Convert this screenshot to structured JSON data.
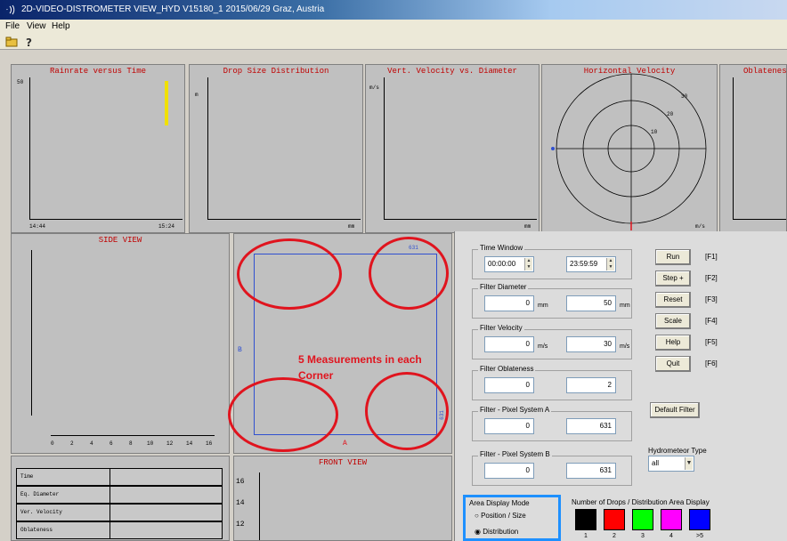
{
  "window": {
    "title": "2D-VIDEO-DISTROMETER   VIEW_HYD   V15180_1   2015/06/29   Graz, Austria"
  },
  "menu": [
    "File",
    "View",
    "Help"
  ],
  "toolbar_icons": [
    "folder-open-icon",
    "help-icon"
  ],
  "panels": {
    "rain_rate": {
      "title": "Rainrate versus Time",
      "y_top": "50",
      "x_left": "14:44",
      "x_right": "15:24"
    },
    "dsd": {
      "title": "Drop Size Distribution",
      "y_unit": "m",
      "x_unit": "mm"
    },
    "vel_diam": {
      "title": "Vert. Velocity vs. Diameter",
      "y_unit": "m/s",
      "x_unit": "mm"
    },
    "horiz_vel": {
      "title": "Horizontal Velocity",
      "ring_labels": [
        "10",
        "20",
        "30"
      ],
      "unit": "m/s"
    },
    "oblateness": {
      "title": "Oblateness"
    },
    "side_view": {
      "title": "SIDE VIEW",
      "x_ticks": [
        "0",
        "2",
        "4",
        "6",
        "8",
        "10",
        "12",
        "14",
        "16"
      ]
    },
    "camera_a": {
      "x_label": "A",
      "y_label": "B",
      "corner_label": "631",
      "side_label": "631"
    },
    "front_view": {
      "title": "FRONT VIEW",
      "y_ticks": [
        "16",
        "14",
        "12"
      ]
    }
  },
  "annotation": {
    "line1": "5 Measurements in each",
    "line2": "Corner"
  },
  "info_table": [
    "Time",
    "Eq. Diameter",
    "Ver. Velocity",
    "Oblateness"
  ],
  "controls": {
    "time_window": {
      "label": "Time Window",
      "start": "00:00:00",
      "end": "23:59:59"
    },
    "filter_diameter": {
      "label": "Filter Diameter",
      "min": "0",
      "max": "50",
      "unit": "mm"
    },
    "filter_velocity": {
      "label": "Filter Velocity",
      "min": "0",
      "max": "30",
      "unit": "m/s"
    },
    "filter_oblateness": {
      "label": "Filter Oblateness",
      "min": "0",
      "max": "2"
    },
    "filter_pixel_a": {
      "label": "Filter - Pixel System A",
      "min": "0",
      "max": "631"
    },
    "filter_pixel_b": {
      "label": "Filter - Pixel System B",
      "min": "0",
      "max": "631"
    },
    "buttons": [
      {
        "label": "Run",
        "key": "[F1]"
      },
      {
        "label": "Step +",
        "key": "[F2]"
      },
      {
        "label": "Reset",
        "key": "[F3]"
      },
      {
        "label": "Scale",
        "key": "[F4]"
      },
      {
        "label": "Help",
        "key": "[F5]"
      },
      {
        "label": "Quit",
        "key": "[F6]"
      }
    ],
    "default_filter": "Default Filter",
    "hydrometeor_type": {
      "label": "Hydrometeor Type",
      "value": "all"
    },
    "area_display": {
      "label": "Area Display Mode",
      "opt1": "Position / Size",
      "opt2": "Distribution",
      "selected": "Distribution"
    },
    "drops_display": {
      "label": "Number of Drops / Distribution Area Display",
      "swatches": [
        {
          "color": "#000000",
          "label": "1"
        },
        {
          "color": "#ff0000",
          "label": "2"
        },
        {
          "color": "#00ff00",
          "label": "3"
        },
        {
          "color": "#ff00ff",
          "label": "4"
        },
        {
          "color": "#0000ff",
          "label": ">5"
        }
      ]
    }
  },
  "colors": {
    "title_text": "#c00000",
    "annotation": "#e0141e",
    "highlight_border": "#1e90ff",
    "camera_frame": "#3050d0",
    "rain_trace": "#f0e000"
  }
}
